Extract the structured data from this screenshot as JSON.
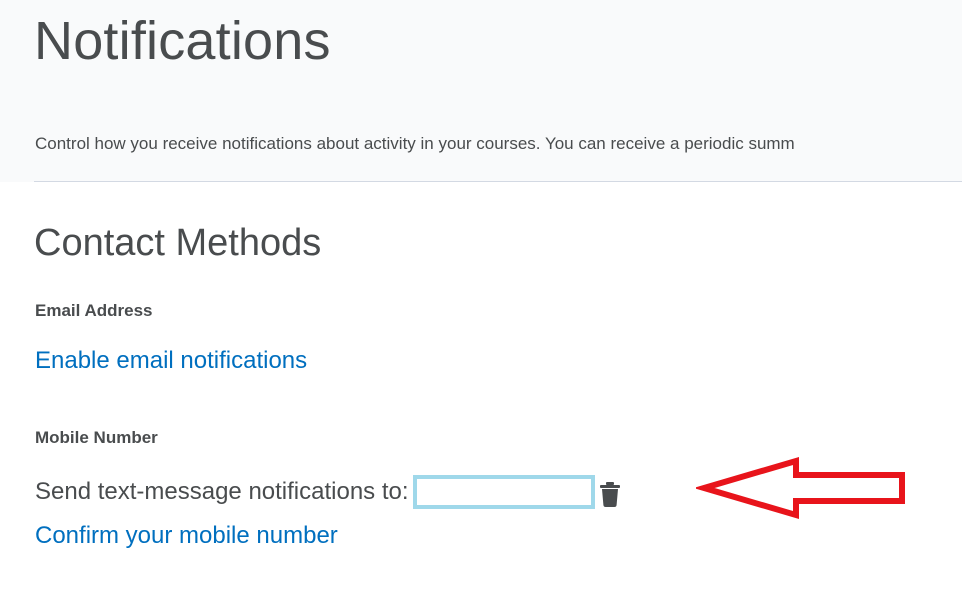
{
  "page": {
    "title": "Notifications",
    "description": "Control how you receive notifications about activity in your courses. You can receive a periodic summ"
  },
  "contact_methods": {
    "title": "Contact Methods",
    "email": {
      "label": "Email Address",
      "link": "Enable email notifications"
    },
    "mobile": {
      "label": "Mobile Number",
      "send_text": "Send text-message notifications to:",
      "phone_value": "",
      "delete_icon": "trash-icon",
      "confirm_link": "Confirm your mobile number"
    }
  },
  "annotation": {
    "type": "arrow",
    "direction": "left",
    "color": "#e8141b"
  },
  "colors": {
    "link": "#006fbf",
    "text": "#494c4e",
    "phone_highlight": "#9fd8ea",
    "header_background": "#f9fafb"
  }
}
